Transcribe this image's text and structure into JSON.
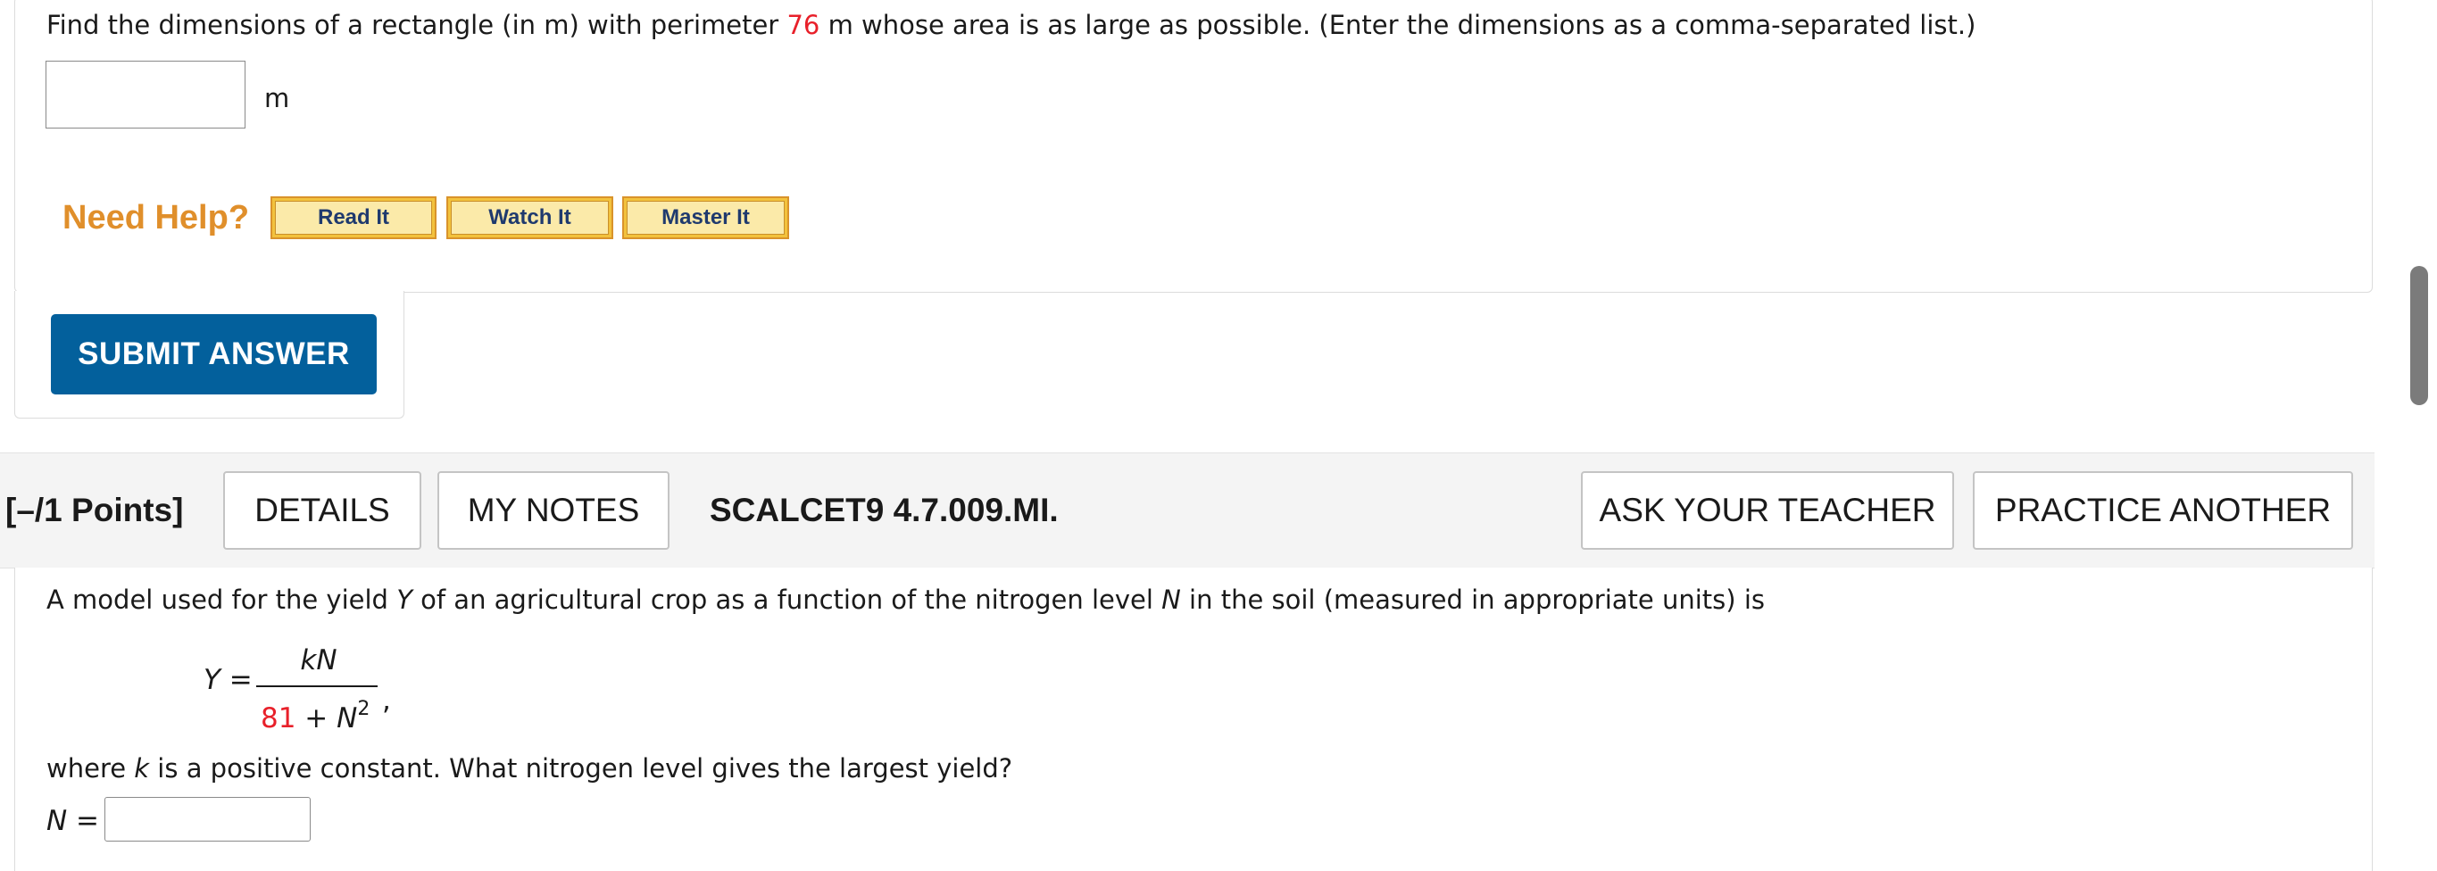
{
  "question1": {
    "text_before": "Find the dimensions of a rectangle (in m) with perimeter ",
    "perimeter_value": "76",
    "text_after": " m whose area is as large as possible. (Enter the dimensions as a comma-separated list.)",
    "answer_value": "",
    "unit": "m",
    "need_help_label": "Need Help?",
    "help_buttons": {
      "read_it": "Read It",
      "watch_it": "Watch It",
      "master_it": "Master It"
    },
    "submit_label": "SUBMIT ANSWER"
  },
  "question2": {
    "points_label": "[–/1 Points]",
    "details_label": "DETAILS",
    "my_notes_label": "MY NOTES",
    "assignment_code": "SCALCET9 4.7.009.MI.",
    "ask_teacher_label": "ASK YOUR TEACHER",
    "practice_another_label": "PRACTICE ANOTHER",
    "intro_a": "A model used for the yield ",
    "var_y": "Y",
    "intro_b": " of an agricultural crop as a function of the nitrogen level ",
    "var_n": "N",
    "intro_c": " in the soil (measured in appropriate units) is",
    "equation": {
      "lhs": "Y =",
      "numerator": "kN",
      "denominator_constant": "81",
      "denominator_rest": " + N",
      "exponent": "2",
      "trailing": ","
    },
    "where_a": "where ",
    "var_k": "k",
    "where_b": " is a positive constant. What nitrogen level gives the largest yield?",
    "answer_label": "N =",
    "answer_value": ""
  },
  "colors": {
    "accent_red": "#e8202a",
    "submit_blue": "#03609c",
    "help_orange": "#e08f2b",
    "help_button_yellow": "#f2c23d"
  }
}
